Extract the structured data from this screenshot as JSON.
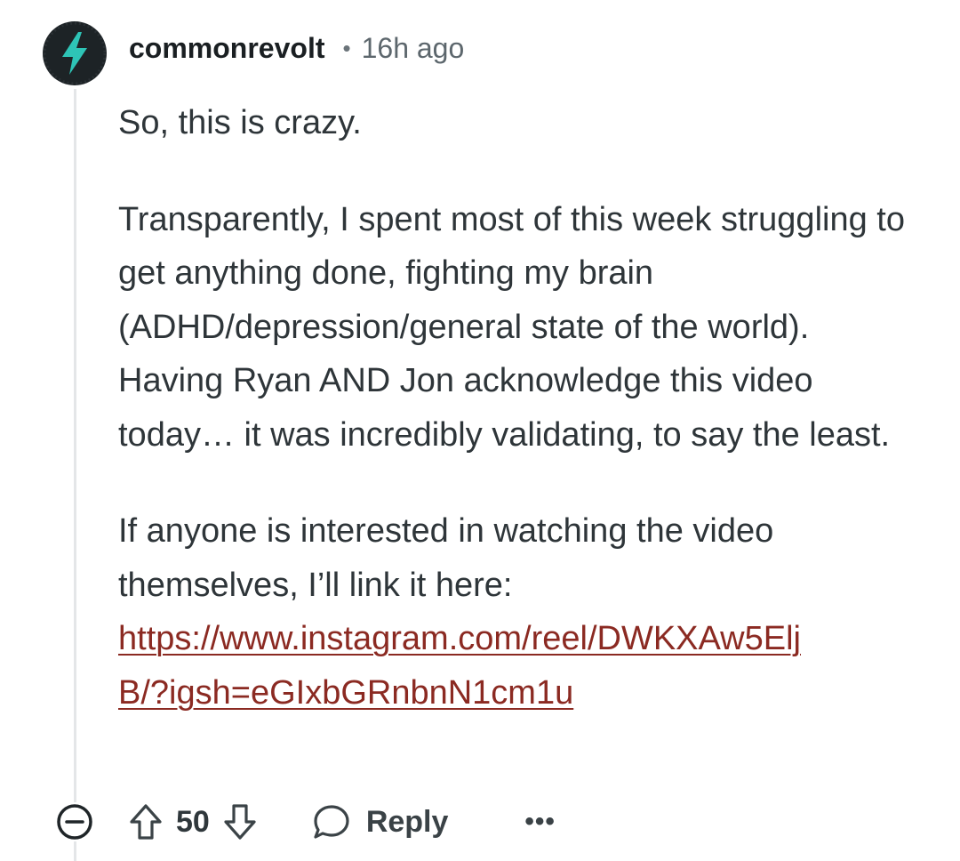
{
  "comment": {
    "author": "commonrevolt",
    "separator": "•",
    "timestamp": "16h ago",
    "avatar_icon": "lightning-bolt-icon",
    "paragraphs": {
      "p1": "So, this is crazy.",
      "p2": "Transparently, I spent most of this week struggling to get anything done, fighting my brain (ADHD/depression/general state of the world). Having Ryan AND Jon acknowledge this video today… it was incredibly validating, to say the least.",
      "p3": "If anyone is interested in watching the video themselves, I’ll link it here:"
    },
    "link": {
      "text": "https://www.instagram.com/reel/DWKXAw5EljB/?igsh=eGIxbGRnbnN1cm1u"
    }
  },
  "actions": {
    "score": "50",
    "reply_label": "Reply",
    "more_label": "•••"
  },
  "colors": {
    "link": "#8b2a22",
    "avatar_bg": "#1d2326",
    "avatar_bolt": "#2ec4b6"
  }
}
